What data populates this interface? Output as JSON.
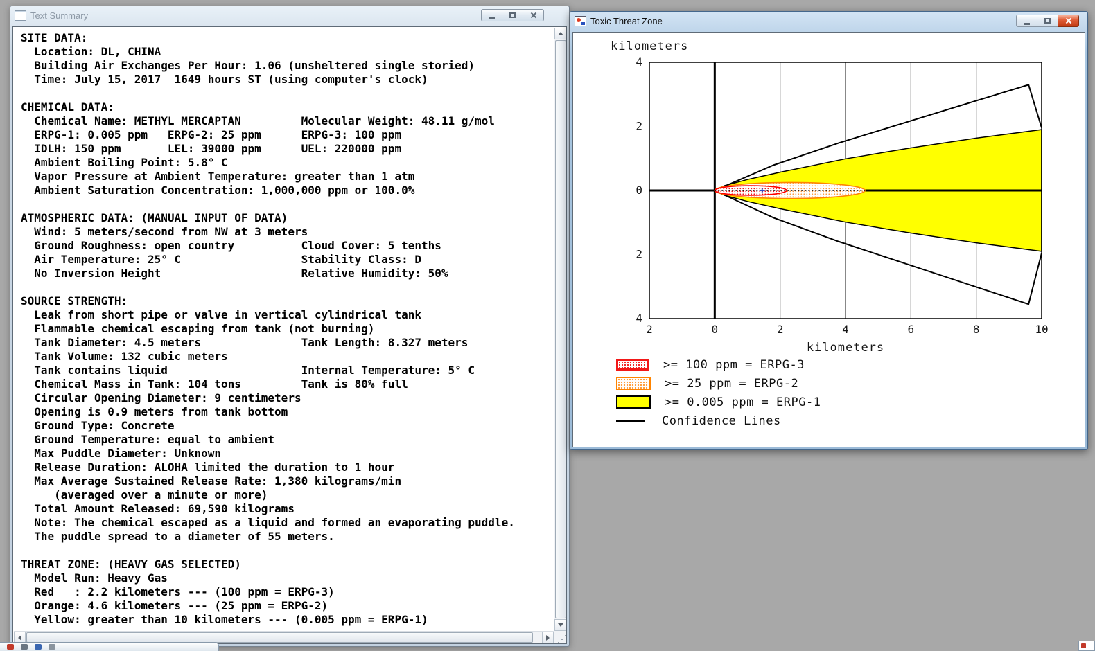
{
  "desktop": {
    "background": "#a8a8a8"
  },
  "text_summary_window": {
    "title": "Text Summary",
    "icon": "document-icon",
    "lines": [
      "SITE DATA:",
      "  Location: DL, CHINA",
      "  Building Air Exchanges Per Hour: 1.06 (unsheltered single storied)",
      "  Time: July 15, 2017  1649 hours ST (using computer's clock)",
      "",
      "CHEMICAL DATA:",
      "  Chemical Name: METHYL MERCAPTAN         Molecular Weight: 48.11 g/mol",
      "  ERPG-1: 0.005 ppm   ERPG-2: 25 ppm      ERPG-3: 100 ppm",
      "  IDLH: 150 ppm       LEL: 39000 ppm      UEL: 220000 ppm",
      "  Ambient Boiling Point: 5.8° C",
      "  Vapor Pressure at Ambient Temperature: greater than 1 atm",
      "  Ambient Saturation Concentration: 1,000,000 ppm or 100.0%",
      "",
      "ATMOSPHERIC DATA: (MANUAL INPUT OF DATA)",
      "  Wind: 5 meters/second from NW at 3 meters",
      "  Ground Roughness: open country          Cloud Cover: 5 tenths",
      "  Air Temperature: 25° C                  Stability Class: D",
      "  No Inversion Height                     Relative Humidity: 50%",
      "",
      "SOURCE STRENGTH:",
      "  Leak from short pipe or valve in vertical cylindrical tank",
      "  Flammable chemical escaping from tank (not burning)",
      "  Tank Diameter: 4.5 meters               Tank Length: 8.327 meters",
      "  Tank Volume: 132 cubic meters",
      "  Tank contains liquid                    Internal Temperature: 5° C",
      "  Chemical Mass in Tank: 104 tons         Tank is 80% full",
      "  Circular Opening Diameter: 9 centimeters",
      "  Opening is 0.9 meters from tank bottom",
      "  Ground Type: Concrete",
      "  Ground Temperature: equal to ambient",
      "  Max Puddle Diameter: Unknown",
      "  Release Duration: ALOHA limited the duration to 1 hour",
      "  Max Average Sustained Release Rate: 1,380 kilograms/min",
      "     (averaged over a minute or more)",
      "  Total Amount Released: 69,590 kilograms",
      "  Note: The chemical escaped as a liquid and formed an evaporating puddle.",
      "  The puddle spread to a diameter of 55 meters.",
      "",
      "THREAT ZONE: (HEAVY GAS SELECTED)",
      "  Model Run: Heavy Gas",
      "  Red   : 2.2 kilometers --- (100 ppm = ERPG-3)",
      "  Orange: 4.6 kilometers --- (25 ppm = ERPG-2)",
      "  Yellow: greater than 10 kilometers --- (0.005 ppm = ERPG-1)"
    ]
  },
  "threat_zone_window": {
    "title": "Toxic Threat Zone",
    "icon": "app-icon"
  },
  "chart_data": {
    "type": "area",
    "title": "Toxic Threat Zone",
    "xlabel": "kilometers",
    "ylabel": "kilometers",
    "xlim": [
      -2,
      10
    ],
    "ylim": [
      -4,
      4
    ],
    "xticks": [
      -2,
      0,
      2,
      4,
      6,
      8,
      10
    ],
    "xtick_labels": [
      "2",
      "0",
      "2",
      "4",
      "6",
      "8",
      "10"
    ],
    "yticks": [
      4,
      2,
      0,
      -2,
      -4
    ],
    "ytick_labels": [
      "4",
      "2",
      "0",
      "2",
      "4"
    ],
    "grid": "vertical-only",
    "zones": [
      {
        "id": "yellow",
        "level": "ERPG-1",
        "threshold": ">= 0.005 ppm",
        "extent_km": 10,
        "extent_note": "greater than 10 kilometers",
        "half_width_km": 1.9,
        "color": "#ffff00",
        "outline": "#000000",
        "shape": "wedge",
        "fill": "solid"
      },
      {
        "id": "orange",
        "level": "ERPG-2",
        "threshold": ">= 25 ppm",
        "extent_km": 4.6,
        "half_width_km": 0.25,
        "color": "#ff9a3c",
        "outline": "#ff8400",
        "shape": "lobe",
        "fill": "stipple"
      },
      {
        "id": "red",
        "level": "ERPG-3",
        "threshold": ">= 100 ppm",
        "extent_km": 2.2,
        "half_width_km": 0.15,
        "color": "#f21818",
        "outline": "#ff0000",
        "shape": "lobe",
        "fill": "stipple"
      }
    ],
    "confidence_lines": {
      "label": "Confidence Lines",
      "color": "#000000",
      "extent_km": 10,
      "upper_half_width_km": 3.3,
      "lower_half_width_km": 3.55
    },
    "source_point": {
      "x_km": 1.45,
      "y_km": 0,
      "marker": "cross",
      "color": "#2244cc"
    },
    "legend": [
      {
        "zone": "red",
        "swatch": "red-stipple",
        "text": ">= 100 ppm = ERPG-3"
      },
      {
        "zone": "orange",
        "swatch": "orange-stipple",
        "text": ">= 25 ppm = ERPG-2"
      },
      {
        "zone": "yellow",
        "swatch": "yellow-solid",
        "text": ">= 0.005 ppm = ERPG-1"
      },
      {
        "zone": "confidence",
        "swatch": "black-line",
        "text": "Confidence Lines"
      }
    ]
  }
}
